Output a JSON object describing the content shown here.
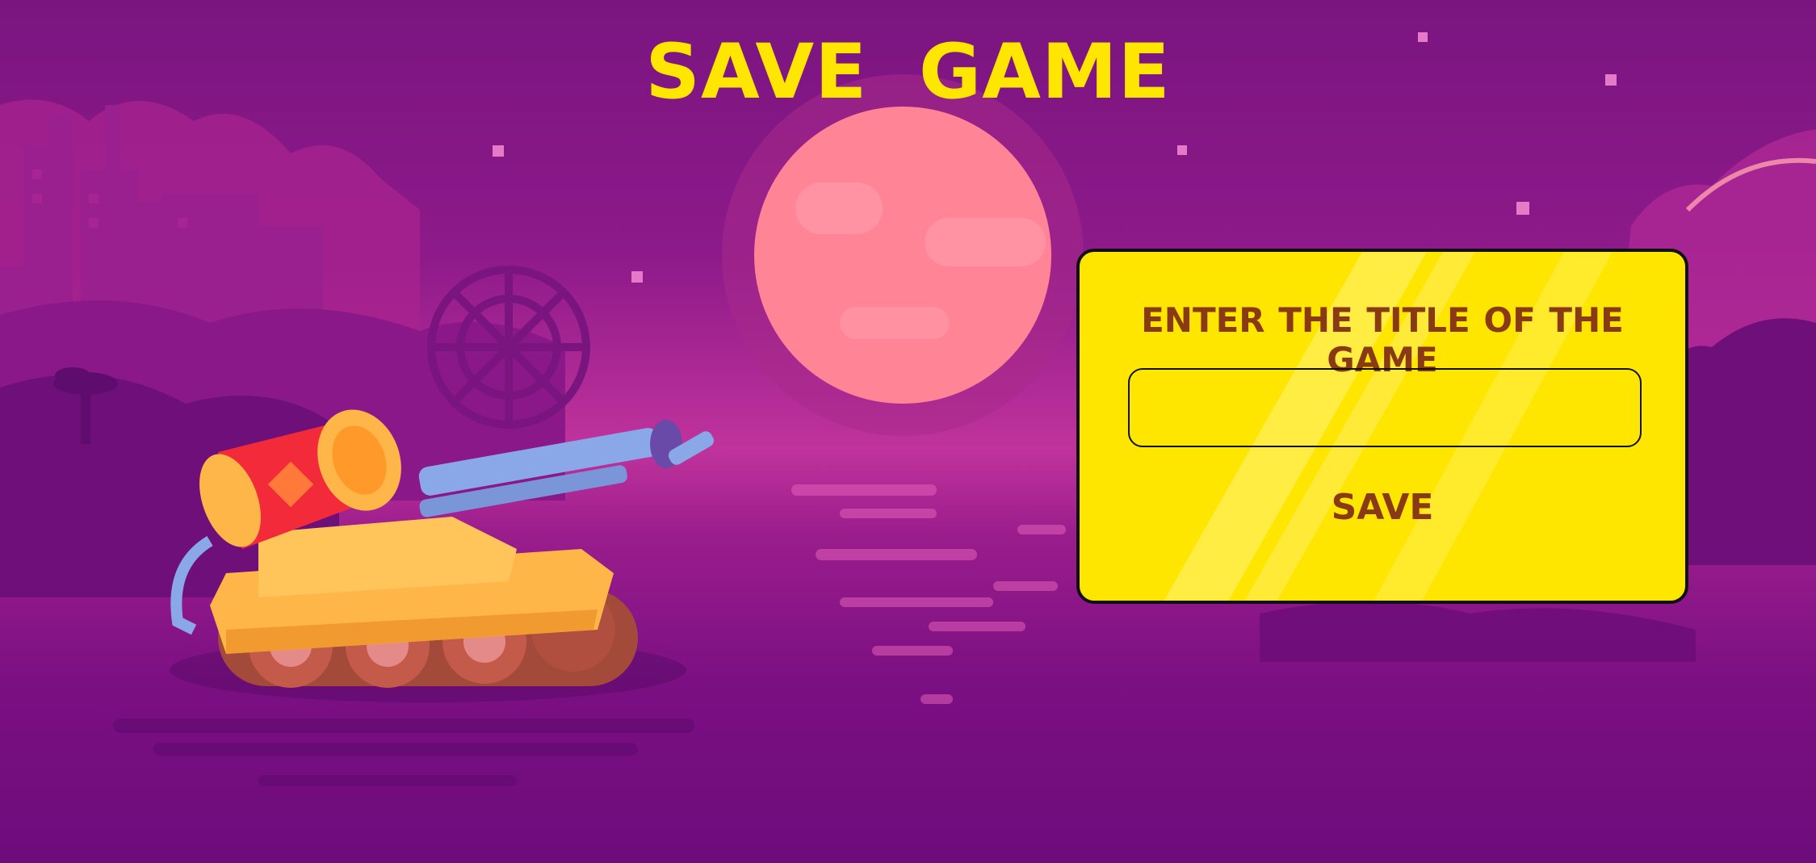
{
  "screen": {
    "title": "SAVE   GAME"
  },
  "dialog": {
    "prompt": "ENTER  THE TITLE OF THE GAME",
    "title_input_value": "",
    "save_label": "SAVE"
  },
  "colors": {
    "title_yellow": "#ffe600",
    "dialog_yellow": "#ffe600",
    "dialog_text_brown": "#8a3a12",
    "sky_purple": "#7a1580",
    "moon_pink": "#ff8496"
  },
  "scene": {
    "player_vehicle": "tank-with-cannon",
    "background": "night-city-by-the-sea"
  }
}
